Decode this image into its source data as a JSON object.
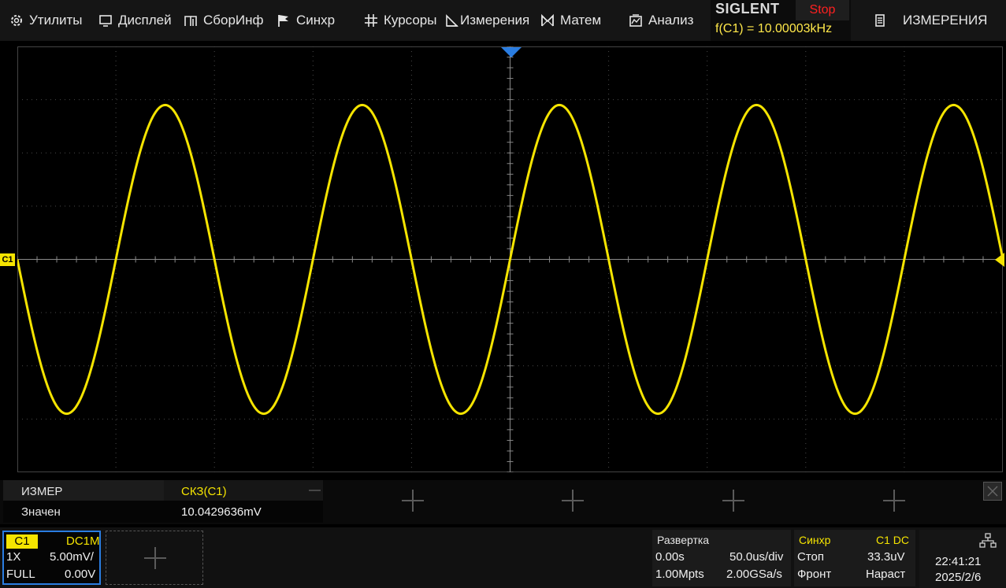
{
  "menu": {
    "utilities": "Утилиты",
    "display": "Дисплей",
    "acquire": "СборИнф",
    "trigger": "Синхр",
    "cursors": "Курсоры",
    "measure": "Измерения",
    "math": "Матем",
    "analysis": "Анализ",
    "right_menu": "ИЗМЕРЕНИЯ"
  },
  "brand": {
    "logo": "SIGLENT",
    "run_state": "Stop",
    "freq_readout": "f(C1) = 10.00003kHz"
  },
  "waveform": {
    "channel_tag": "C1",
    "color": "#f5e400",
    "cycles_visible": 5,
    "amplitude_divisions": 2.9
  },
  "measurement": {
    "header_label": "ИЗМЕР",
    "value_label": "Значен",
    "param": "СКЗ(C1)",
    "value": "10.0429636mV"
  },
  "channel": {
    "name": "C1",
    "coupling": "DC1M",
    "probe": "1X",
    "scale": "5.00mV/",
    "bandwidth": "FULL",
    "offset": "0.00V"
  },
  "timebase": {
    "title": "Развертка",
    "delay": "0.00s",
    "scale": "50.0us/div",
    "memory": "1.00Mpts",
    "sample_rate": "2.00GSa/s"
  },
  "trigger": {
    "title": "Синхр",
    "source": "C1 DC",
    "mode": "Стоп",
    "level": "33.3uV",
    "type": "Фронт",
    "slope": "Нараст"
  },
  "clock": {
    "time": "22:41:21",
    "date": "2025/2/6"
  },
  "colors": {
    "channel1": "#f5e400",
    "trigger_marker": "#2a7de1",
    "stop": "#ff2020",
    "freq_text": "#ffe84a"
  }
}
